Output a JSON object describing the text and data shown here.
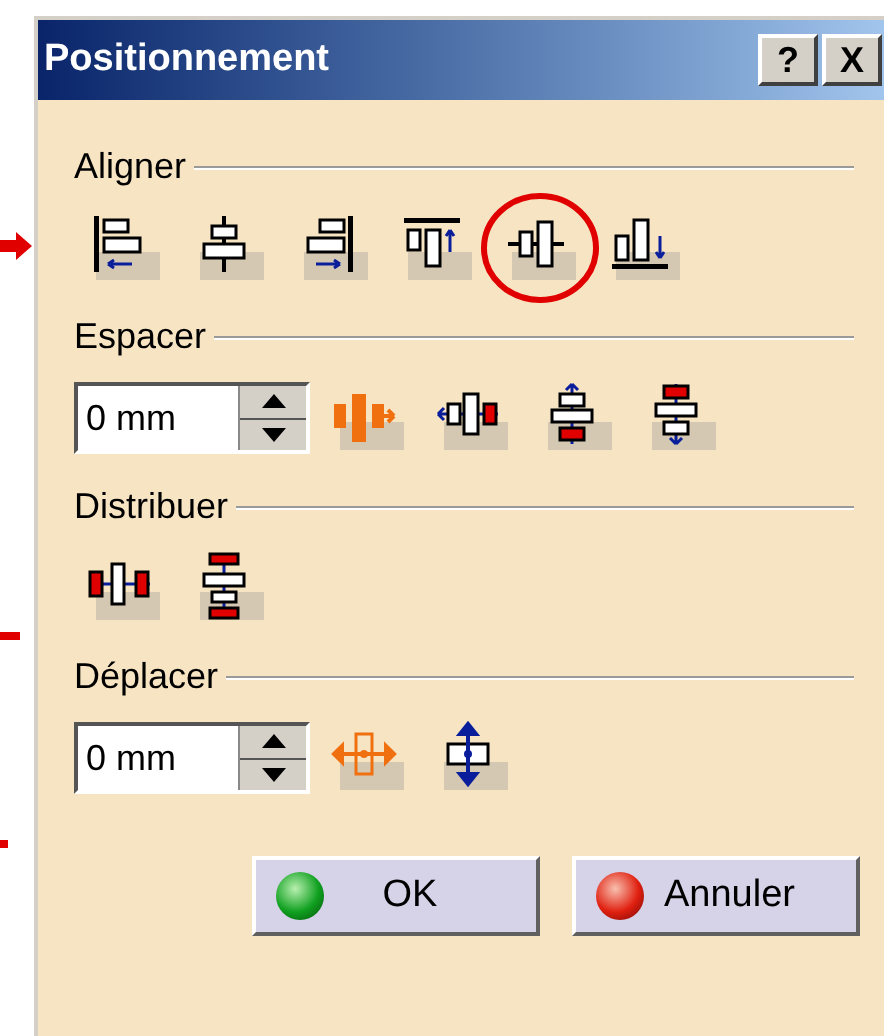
{
  "window": {
    "title": "Positionnement",
    "help_button": "?",
    "close_button": "X"
  },
  "sections": [
    {
      "title": "Aligner",
      "tools": [
        {
          "kind": "alignleft",
          "highlighted": false
        },
        {
          "kind": "aligncenter",
          "highlighted": false
        },
        {
          "kind": "alignright",
          "highlighted": false
        },
        {
          "kind": "aligntop",
          "highlighted": false
        },
        {
          "kind": "alignmiddle",
          "highlighted": true
        },
        {
          "kind": "alignbottom",
          "highlighted": false
        }
      ]
    },
    {
      "title": "Espacer",
      "field": {
        "value": "0 mm"
      },
      "tools": [
        {
          "kind": "spaceactive",
          "highlighted": false
        },
        {
          "kind": "spaceh",
          "highlighted": false
        },
        {
          "kind": "spaceup",
          "highlighted": false
        },
        {
          "kind": "spacedown",
          "highlighted": false
        }
      ]
    },
    {
      "title": "Distribuer",
      "tools": [
        {
          "kind": "distributeh",
          "highlighted": false
        },
        {
          "kind": "distributev",
          "highlighted": false
        }
      ]
    },
    {
      "title": "Déplacer",
      "field": {
        "value": "0 mm"
      },
      "tools": [
        {
          "kind": "moveh",
          "highlighted": false
        },
        {
          "kind": "movev",
          "highlighted": false
        }
      ]
    }
  ],
  "buttons": [
    {
      "label": "OK",
      "kind": "ok"
    },
    {
      "label": "Annuler",
      "kind": "cancel"
    }
  ]
}
